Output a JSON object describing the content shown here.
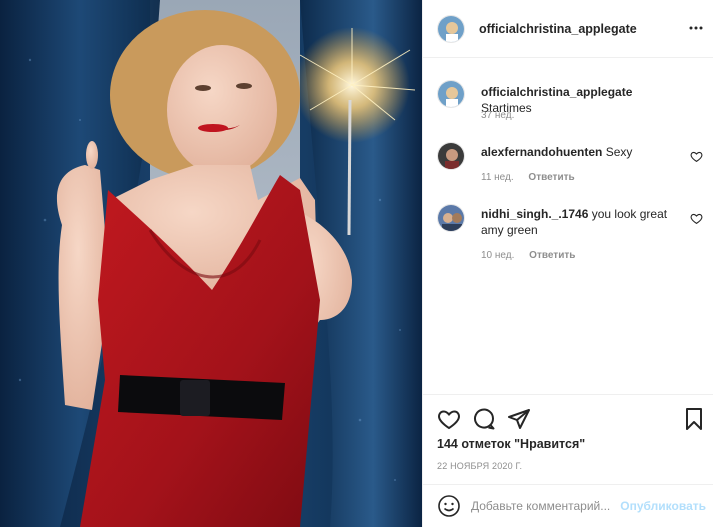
{
  "post": {
    "author": "officialchristina_applegate",
    "caption": "Startimes",
    "caption_age": "37 нед."
  },
  "comments": [
    {
      "username": "alexfernandohuenten",
      "text": "Sexy",
      "age": "11 нед.",
      "reply_label": "Ответить"
    },
    {
      "username": "nidhi_singh._.1746",
      "text": "you look great amy green",
      "age": "10 нед.",
      "reply_label": "Ответить"
    }
  ],
  "actions": {
    "likes_text": "144 отметок \"Нравится\"",
    "date": "22 НОЯБРЯ 2020 Г."
  },
  "add_comment": {
    "placeholder": "Добавьте комментарий...",
    "publish_label": "Опубликовать"
  },
  "colors": {
    "accent_disabled": "#b2dffc",
    "muted": "#8e8e8e",
    "dress": "#b3151b",
    "curtain": "#0e2a47"
  },
  "icons": [
    "more-horizontal-icon",
    "heart-icon",
    "comment-icon",
    "share-icon",
    "bookmark-icon",
    "emoji-icon"
  ]
}
